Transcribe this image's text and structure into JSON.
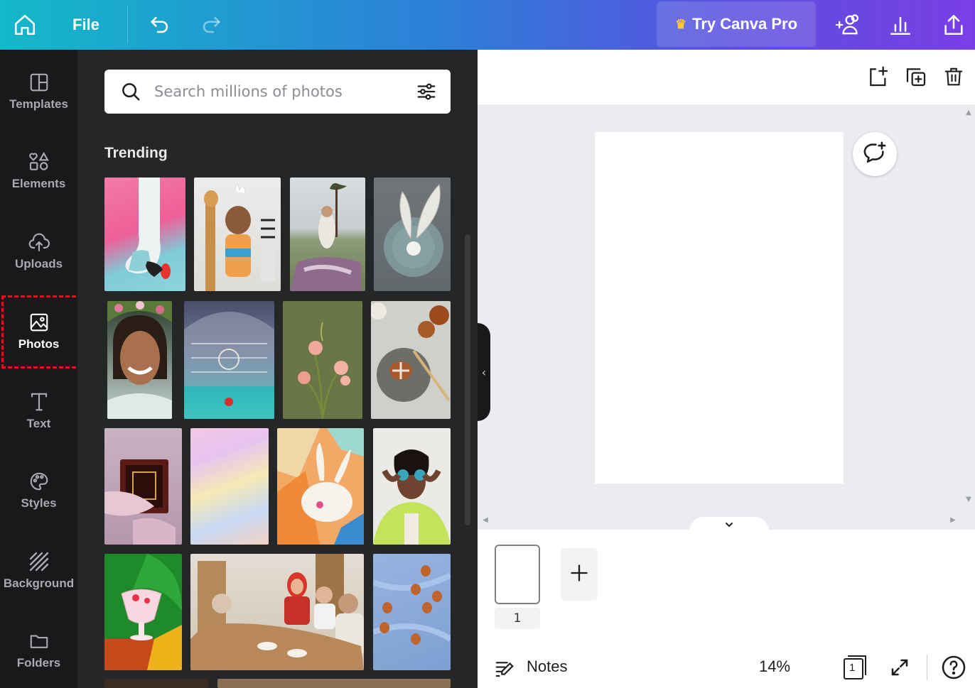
{
  "topbar": {
    "file_label": "File",
    "pro_label": "Try Canva Pro",
    "pro_icon": "crown-icon"
  },
  "rail": {
    "items": [
      {
        "label": "Templates",
        "icon": "templates-icon"
      },
      {
        "label": "Elements",
        "icon": "elements-icon"
      },
      {
        "label": "Uploads",
        "icon": "upload-cloud-icon"
      },
      {
        "label": "Photos",
        "icon": "photo-icon"
      },
      {
        "label": "Text",
        "icon": "text-icon"
      },
      {
        "label": "Styles",
        "icon": "palette-icon"
      },
      {
        "label": "Background",
        "icon": "background-hatch-icon"
      },
      {
        "label": "Folders",
        "icon": "folder-icon"
      }
    ],
    "active": "Photos"
  },
  "panel": {
    "search_placeholder": "Search millions of photos",
    "section_title": "Trending",
    "photos": [
      "pink and blue sock with egg",
      "child with bunny ears and toy giraffe",
      "woman picnic by lake",
      "napkin folded as bunny ears",
      "smiling woman with flower crown",
      "mosque interior",
      "pink flowers on olive background",
      "hot cross buns on plates",
      "hands holding ornate book",
      "pastel holographic gradient",
      "paper craft bunny on colorful paper",
      "woman holding blue eggs over eyes",
      "pink dessert glass on green leaf",
      "family dinner gathering",
      "brown eggs on blue fabric"
    ]
  },
  "editor": {
    "page_number": "1",
    "notes_label": "Notes",
    "zoom": "14%",
    "page_count_badge": "1"
  },
  "colors": {
    "topbar_start": "#14b8c9",
    "topbar_end": "#7a3fe4",
    "rail_bg": "#18191b",
    "panel_bg": "#252627",
    "highlight": "#e0121a"
  }
}
